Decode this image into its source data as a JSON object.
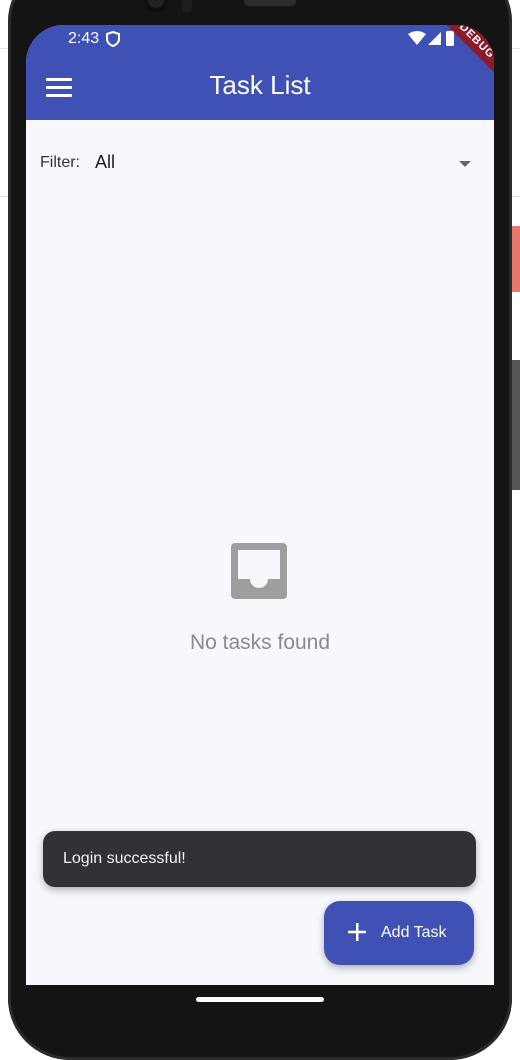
{
  "status_bar": {
    "time": "2:43",
    "icons": [
      "shield-icon",
      "wifi-icon",
      "signal-icon",
      "battery-icon"
    ]
  },
  "debug_banner": "DEBUG",
  "app_bar": {
    "title": "Task List",
    "menu_icon": "menu-icon",
    "color": "#3f51b5"
  },
  "filter": {
    "label": "Filter:",
    "value": "All"
  },
  "empty_state": {
    "icon": "inbox-icon",
    "message": "No tasks found"
  },
  "snackbar": {
    "message": "Login successful!"
  },
  "fab": {
    "label": "Add Task",
    "icon": "plus-icon",
    "color": "#3f51b5"
  }
}
